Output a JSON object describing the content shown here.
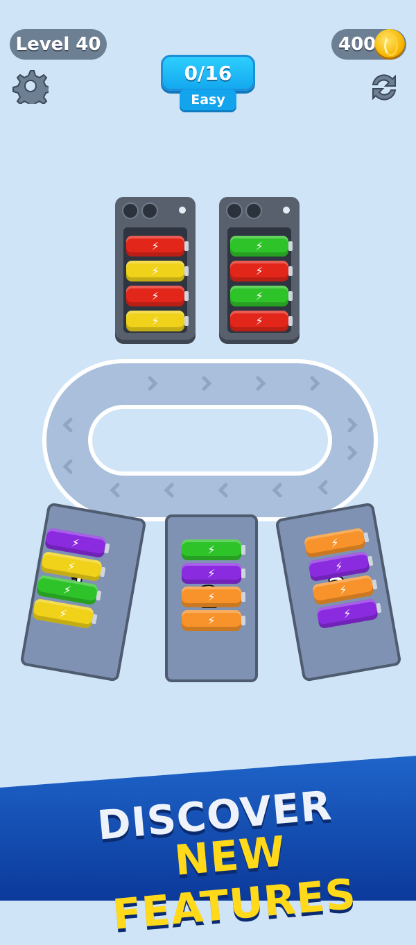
{
  "hud": {
    "level": "Level 40",
    "coins": "400",
    "progress": "0/16",
    "difficulty": "Easy"
  },
  "boxes": [
    {
      "label": "1",
      "batteries": [
        "purple",
        "yellow",
        "green",
        "yellow"
      ]
    },
    {
      "label": "2",
      "batteries": [
        "green",
        "purple",
        "orange",
        "orange"
      ]
    },
    {
      "label": "3",
      "batteries": [
        "orange",
        "purple",
        "orange",
        "purple"
      ]
    }
  ],
  "trays": [
    {
      "batteries": [
        "red",
        "yellow",
        "red",
        "yellow"
      ]
    },
    {
      "batteries": [
        "green",
        "red",
        "green",
        "red"
      ]
    }
  ],
  "banner": {
    "line1": "DISCOVER",
    "line2": "NEW FEATURES"
  },
  "colors": {
    "background": "#cfe4f7",
    "progress": "#12a6ee",
    "banner": "#1f64c9",
    "banner_highlight": "#ffd91a"
  }
}
